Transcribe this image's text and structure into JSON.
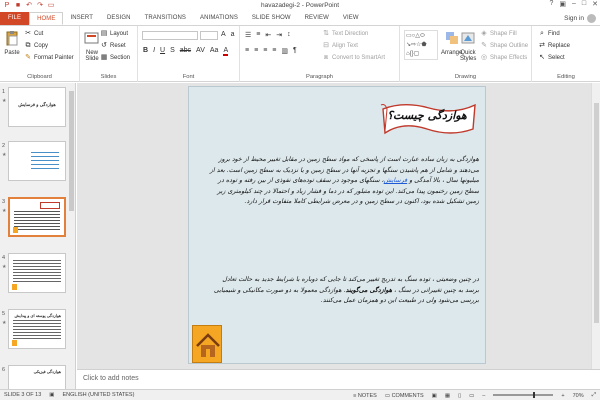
{
  "window": {
    "title": "havazadegi-2 - PowerPoint",
    "signin": "Sign in"
  },
  "tabs": [
    "FILE",
    "HOME",
    "INSERT",
    "DESIGN",
    "TRANSITIONS",
    "ANIMATIONS",
    "SLIDE SHOW",
    "REVIEW",
    "VIEW"
  ],
  "ribbon": {
    "clipboard": {
      "label": "Clipboard",
      "paste": "Paste",
      "cut": "Cut",
      "copy": "Copy",
      "format_painter": "Format Painter"
    },
    "slides": {
      "label": "Slides",
      "new_slide": "New Slide",
      "layout": "Layout",
      "reset": "Reset",
      "section": "Section"
    },
    "font": {
      "label": "Font"
    },
    "paragraph": {
      "label": "Paragraph",
      "text_direction": "Text Direction",
      "align_text": "Align Text",
      "convert_smartart": "Convert to SmartArt"
    },
    "drawing": {
      "label": "Drawing",
      "arrange": "Arrange",
      "quick_styles": "Quick Styles",
      "shape_fill": "Shape Fill",
      "shape_outline": "Shape Outline",
      "shape_effects": "Shape Effects"
    },
    "editing": {
      "label": "Editing",
      "find": "Find",
      "replace": "Replace",
      "select": "Select"
    }
  },
  "thumbs": [
    {
      "num": "1",
      "title": "هوازدگی و فرسایش"
    },
    {
      "num": "2",
      "title": ""
    },
    {
      "num": "3",
      "title": ""
    },
    {
      "num": "4",
      "title": ""
    },
    {
      "num": "5",
      "title": "هوازدگی پوسته ای و پیدایش"
    },
    {
      "num": "6",
      "title": "هوازدگی فیزیکی"
    }
  ],
  "slide": {
    "heading": "هوازدگی چیست؟",
    "p1_a": "هوازدگی به زبان ساده عبارت است از پاسخی که مواد سطح زمین در مقابل تغییر محیط از خود بروز می‌دهند و شامل از هم پاشیدن سنگها و تجزیه آنها در سطح زمین و یا نزدیک به سطح زمین است. بعد از میلیونها سال ، بالا آمدگی و ",
    "p1_link": "فرسایش",
    "p1_b": "، سنگهای موجود در سقف توده‌های نفوذی از بین رفته و توده در سطح زمین رخنمون پیدا می‌کند. این توده متبلور که در دما و فشار زیاد و احتمالا در چند کیلومتری زیر زمین تشکیل شده بود، اکنون در سطح زمین و در معرض شرایطی کاملا متفاوت قرار دارد.",
    "p2_a": "در چنین وضعیتی ، توده سنگ به تدریج تغییر می‌کند تا جایی که دوباره با شرایط جدید به حالت تعادل برسد به چنین تغییراتی در سنگ ، ",
    "p2_bold": "هوازدگی می‌گویند",
    "p2_b": ". هوازدگی معمولا به دو صورت مکانیکی و شیمیایی بررسی می‌شود ولی در طبیعت این دو همزمان عمل می‌کنند."
  },
  "notes_placeholder": "Click to add notes",
  "status": {
    "slide_info": "SLIDE 3 OF 13",
    "language": "ENGLISH (UNITED STATES)",
    "notes": "NOTES",
    "comments": "COMMENTS",
    "zoom": "70%"
  }
}
